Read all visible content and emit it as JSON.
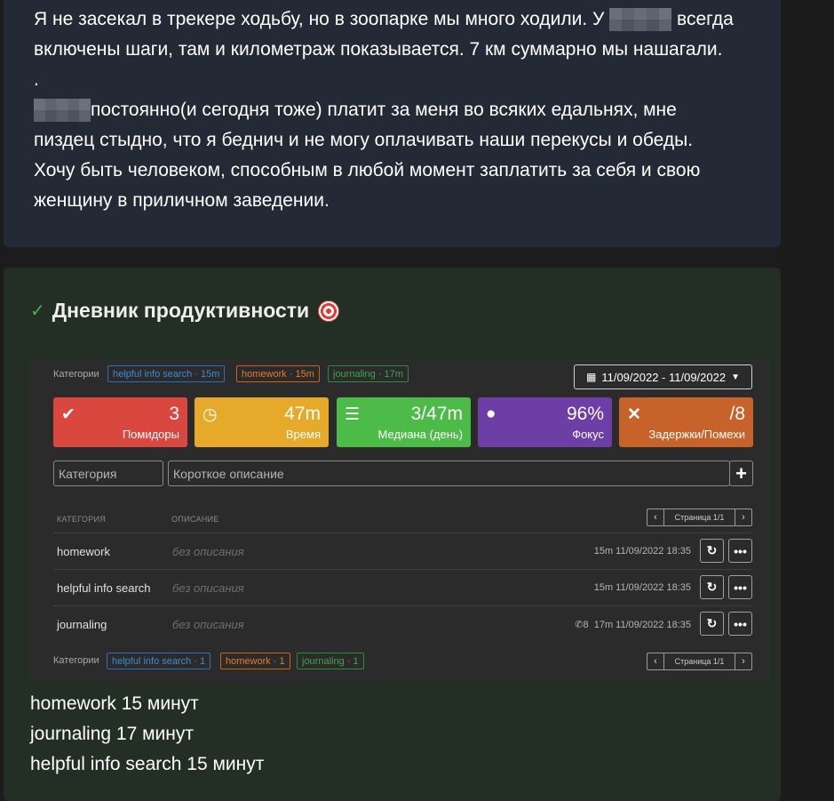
{
  "post": {
    "line1_pre": "Я не засекал в трекере ходьбу, но в зоопарке мы много ходили. У",
    "line1_post": "всегда",
    "line2": "включены шаги, там и километраж показывается. 7 км суммарно мы нашагали.",
    "line3": ".",
    "line4_post": "постоянно(и сегодня тоже) платит за меня во всяких едальнях, мне",
    "line5": "пиздец стыдно, что я беднич и не могу оплачивать наши перекусы и обеды.",
    "line6": "Хочу быть человеком, способным в любой момент заплатить за себя и свою",
    "line7": "женщину в приличном заведении."
  },
  "diary": {
    "title": "Дневник продуктивности"
  },
  "widget": {
    "categories_label": "Категории",
    "top_tags": [
      "helpful info search · 15m",
      "homework · 15m",
      "journaling · 17m"
    ],
    "date_range": "11/09/2022 - 11/09/2022",
    "stats": [
      {
        "value": "3",
        "label": "Помидоры",
        "color": "#d9473f",
        "icon": "check-circle-icon"
      },
      {
        "value": "47m",
        "label": "Время",
        "color": "#e6a92a",
        "icon": "clock-icon"
      },
      {
        "value": "3/47m",
        "label": "Медиана (день)",
        "color": "#4dbb48",
        "icon": "list-icon"
      },
      {
        "value": "96%",
        "label": "Фокус",
        "color": "#6d3fa6",
        "icon": "lightbulb-icon"
      },
      {
        "value": "/8",
        "label": "Задержки/Помехи",
        "color": "#c7622a",
        "icon": "close-icon"
      }
    ],
    "category_placeholder": "Категория",
    "description_placeholder": "Короткое описание",
    "col_category": "КАТЕГОРИЯ",
    "col_description": "ОПИСАНИЕ",
    "page": "Страница 1/1",
    "rows": [
      {
        "category": "homework",
        "description": "без описания",
        "calls": "",
        "meta": "15m 11/09/2022 18:35"
      },
      {
        "category": "helpful info search",
        "description": "без описания",
        "calls": "",
        "meta": "15m 11/09/2022 18:35"
      },
      {
        "category": "journaling",
        "description": "без описания",
        "calls": "8",
        "meta": "17m 11/09/2022 18:35"
      }
    ],
    "bottom_tags": [
      "helpful info search · 1",
      "homework · 1",
      "journaling · 1"
    ]
  },
  "summary": [
    "homework 15 минут",
    "journaling 17 минут",
    "helpful info search 15 минут"
  ]
}
